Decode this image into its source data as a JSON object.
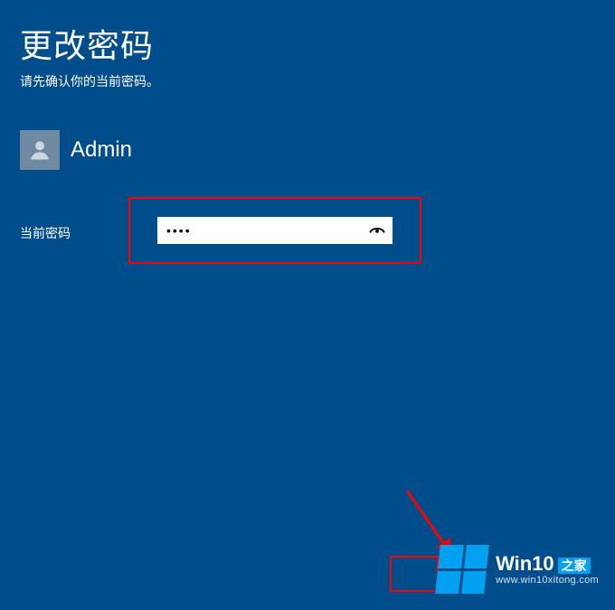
{
  "title": "更改密码",
  "subtitle": "请先确认你的当前密码。",
  "user": {
    "name": "Admin"
  },
  "form": {
    "current_password_label": "当前密码",
    "current_password_value": "••••",
    "current_password_placeholder": ""
  },
  "icons": {
    "avatar": "person-icon",
    "reveal": "eye-icon"
  },
  "watermark": {
    "brand": "Win10",
    "brand_suffix": "之家",
    "url": "www.win10xitong.com"
  }
}
